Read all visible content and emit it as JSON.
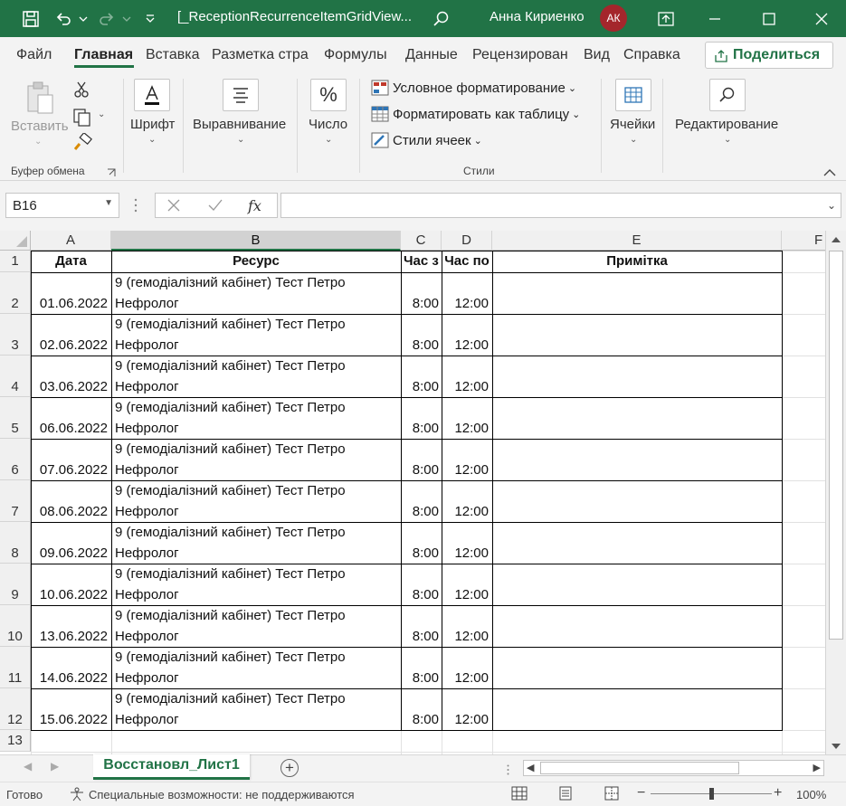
{
  "window": {
    "title": "[_ReceptionRecurrenceItemGridView...",
    "user_name": "Анна Кириенко",
    "user_initials": "АК",
    "accent_color": "#217346"
  },
  "menu": {
    "tabs": [
      "Файл",
      "Главная",
      "Вставка",
      "Разметка стра",
      "Формулы",
      "Данные",
      "Рецензирован",
      "Вид",
      "Справка"
    ],
    "active_tab": "Главная",
    "share_label": "Поделиться"
  },
  "ribbon": {
    "paste_label": "Вставить",
    "clipboard_group": "Буфер обмена",
    "font_label": "Шрифт",
    "align_label": "Выравнивание",
    "number_label": "Число",
    "cond_format": "Условное форматирование",
    "format_table": "Форматировать как таблицу",
    "cell_styles": "Стили ячеек",
    "styles_group": "Стили",
    "cells_label": "Ячейки",
    "editing_label": "Редактирование"
  },
  "formula_bar": {
    "name_box": "B16",
    "fx": "fx",
    "formula": ""
  },
  "grid": {
    "columns": [
      "A",
      "B",
      "C",
      "D",
      "E",
      "F"
    ],
    "selected_column": "B",
    "headers": [
      "Дата",
      "Ресурс",
      "Час з",
      "Час по",
      "Примітка"
    ],
    "rows": [
      {
        "num": "2",
        "date": "01.06.2022",
        "res1": "9 (гемодіалізний кабінет) Тест Петро",
        "res2": "Нефролог",
        "from": "8:00",
        "to": "12:00"
      },
      {
        "num": "3",
        "date": "02.06.2022",
        "res1": "9 (гемодіалізний кабінет) Тест Петро",
        "res2": "Нефролог",
        "from": "8:00",
        "to": "12:00"
      },
      {
        "num": "4",
        "date": "03.06.2022",
        "res1": "9 (гемодіалізний кабінет) Тест Петро",
        "res2": "Нефролог",
        "from": "8:00",
        "to": "12:00"
      },
      {
        "num": "5",
        "date": "06.06.2022",
        "res1": "9 (гемодіалізний кабінет) Тест Петро",
        "res2": "Нефролог",
        "from": "8:00",
        "to": "12:00"
      },
      {
        "num": "6",
        "date": "07.06.2022",
        "res1": "9 (гемодіалізний кабінет) Тест Петро",
        "res2": "Нефролог",
        "from": "8:00",
        "to": "12:00"
      },
      {
        "num": "7",
        "date": "08.06.2022",
        "res1": "9 (гемодіалізний кабінет) Тест Петро",
        "res2": "Нефролог",
        "from": "8:00",
        "to": "12:00"
      },
      {
        "num": "8",
        "date": "09.06.2022",
        "res1": "9 (гемодіалізний кабінет) Тест Петро",
        "res2": "Нефролог",
        "from": "8:00",
        "to": "12:00"
      },
      {
        "num": "9",
        "date": "10.06.2022",
        "res1": "9 (гемодіалізний кабінет) Тест Петро",
        "res2": "Нефролог",
        "from": "8:00",
        "to": "12:00"
      },
      {
        "num": "10",
        "date": "13.06.2022",
        "res1": "9 (гемодіалізний кабінет) Тест Петро",
        "res2": "Нефролог",
        "from": "8:00",
        "to": "12:00"
      },
      {
        "num": "11",
        "date": "14.06.2022",
        "res1": "9 (гемодіалізний кабінет) Тест Петро",
        "res2": "Нефролог",
        "from": "8:00",
        "to": "12:00"
      },
      {
        "num": "12",
        "date": "15.06.2022",
        "res1": "9 (гемодіалізний кабінет) Тест Петро",
        "res2": "Нефролог",
        "from": "8:00",
        "to": "12:00"
      }
    ]
  },
  "sheets": {
    "active": "Восстановл_Лист1"
  },
  "status": {
    "ready": "Готово",
    "accessibility": "Специальные возможности: не поддерживаются",
    "zoom": "100%"
  }
}
